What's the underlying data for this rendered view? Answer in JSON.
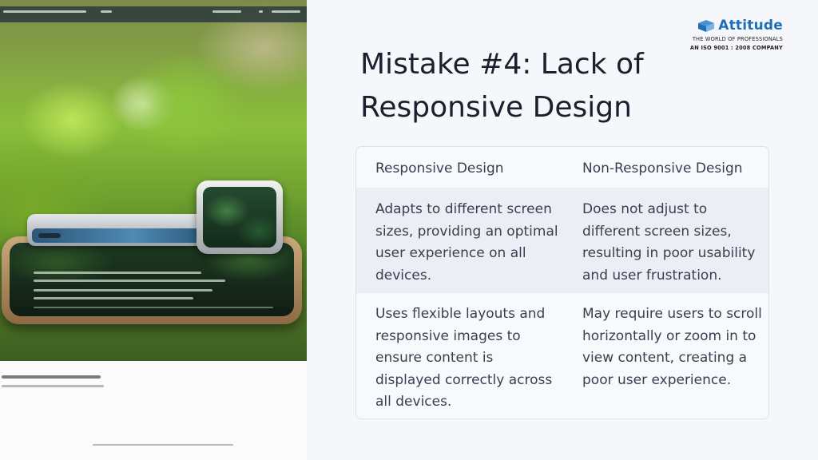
{
  "logo": {
    "name": "Attitude",
    "tagline": "THE WORLD OF PROFESSIONALS",
    "certification": "AN ISO 9001 : 2008 COMPANY",
    "brand_color": "#1f6fb8"
  },
  "slide": {
    "title": "Mistake #4: Lack of Responsive Design"
  },
  "table": {
    "headers": [
      "Responsive Design",
      "Non-Responsive Design"
    ],
    "rows": [
      {
        "responsive": "Adapts to different screen sizes, providing an optimal user experience on all devices.",
        "non_responsive": "Does not adjust to different screen sizes, resulting in poor usability and user frustration."
      },
      {
        "responsive": "Uses flexible layouts and responsive images to ensure content is displayed correctly across all devices.",
        "non_responsive": "May require users to scroll horizontally or zoom in to view content, creating a poor user experience."
      }
    ]
  },
  "image": {
    "icon": "device-photo-icon"
  },
  "colors": {
    "title": "#1c1f2e",
    "text": "#3a3e4e",
    "row_shade": "#eceef6",
    "border": "#dfe1ea"
  }
}
